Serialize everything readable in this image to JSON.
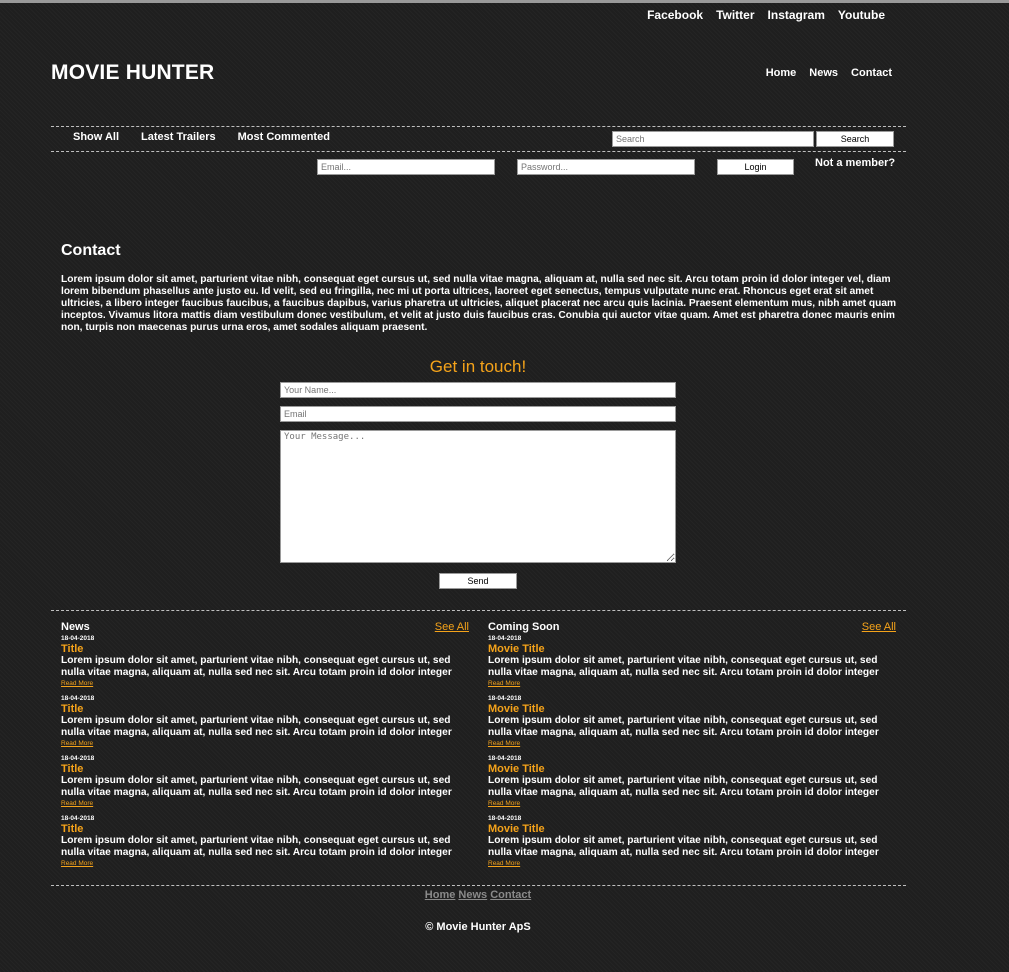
{
  "social": [
    "Facebook",
    "Twitter",
    "Instagram",
    "Youtube"
  ],
  "site_title": "MOVIE HUNTER",
  "main_nav": [
    "Home",
    "News",
    "Contact"
  ],
  "sub_nav": [
    "Show All",
    "Latest Trailers",
    "Most Commented"
  ],
  "search": {
    "placeholder": "Search",
    "button": "Search"
  },
  "login": {
    "email_placeholder": "Email...",
    "password_placeholder": "Password...",
    "button": "Login",
    "member_text": "Not a member?"
  },
  "contact": {
    "title": "Contact",
    "body": "Lorem ipsum dolor sit amet, parturient vitae nibh, consequat eget cursus ut, sed nulla vitae magna, aliquam at, nulla sed nec sit. Arcu totam proin id dolor integer vel, diam lorem bibendum phasellus ante justo eu. Id velit, sed eu fringilla, nec mi ut porta ultrices, laoreet eget senectus, tempus vulputate nunc erat. Rhoncus eget erat sit amet ultricies, a libero integer faucibus faucibus, a faucibus dapibus, varius pharetra ut ultricies, aliquet placerat nec arcu quis lacinia. Praesent elementum mus, nibh amet quam inceptos. Vivamus litora mattis diam vestibulum donec vestibulum, et velit at justo duis faucibus cras. Conubia qui auctor vitae quam. Amet est pharetra donec mauris enim non, turpis non maecenas purus urna eros, amet sodales aliquam praesent."
  },
  "form": {
    "heading": "Get in touch!",
    "name_placeholder": "Your Name...",
    "email_placeholder": "Email",
    "message_placeholder": "Your Message...",
    "send": "Send"
  },
  "news": {
    "heading": "News",
    "see_all": "See All",
    "items": [
      {
        "date": "18-04-2018",
        "title": "Title",
        "text": "Lorem ipsum dolor sit amet, parturient vitae nibh, consequat eget cursus ut, sed nulla vitae magna, aliquam at, nulla sed nec sit. Arcu totam proin id dolor integer vel, dia...",
        "read_more": "Read More"
      },
      {
        "date": "18-04-2018",
        "title": "Title",
        "text": "Lorem ipsum dolor sit amet, parturient vitae nibh, consequat eget cursus ut, sed nulla vitae magna, aliquam at, nulla sed nec sit. Arcu totam proin id dolor integer vel, dia...",
        "read_more": "Read More"
      },
      {
        "date": "18-04-2018",
        "title": "Title",
        "text": "Lorem ipsum dolor sit amet, parturient vitae nibh, consequat eget cursus ut, sed nulla vitae magna, aliquam at, nulla sed nec sit. Arcu totam proin id dolor integer vel, dia...",
        "read_more": "Read More"
      },
      {
        "date": "18-04-2018",
        "title": "Title",
        "text": "Lorem ipsum dolor sit amet, parturient vitae nibh, consequat eget cursus ut, sed nulla vitae magna, aliquam at, nulla sed nec sit. Arcu totam proin id dolor integer vel, dia...",
        "read_more": "Read More"
      }
    ]
  },
  "coming_soon": {
    "heading": "Coming Soon",
    "see_all": "See All",
    "items": [
      {
        "date": "18-04-2018",
        "title": "Movie Title",
        "text": "Lorem ipsum dolor sit amet, parturient vitae nibh, consequat eget cursus ut, sed nulla vitae magna, aliquam at, nulla sed nec sit. Arcu totam proin id dolor integer vel, dia...",
        "read_more": "Read More"
      },
      {
        "date": "18-04-2018",
        "title": "Movie Title",
        "text": "Lorem ipsum dolor sit amet, parturient vitae nibh, consequat eget cursus ut, sed nulla vitae magna, aliquam at, nulla sed nec sit. Arcu totam proin id dolor integer vel, dia...",
        "read_more": "Read More"
      },
      {
        "date": "18-04-2018",
        "title": "Movie Title",
        "text": "Lorem ipsum dolor sit amet, parturient vitae nibh, consequat eget cursus ut, sed nulla vitae magna, aliquam at, nulla sed nec sit. Arcu totam proin id dolor integer vel, dia...",
        "read_more": "Read More"
      },
      {
        "date": "18-04-2018",
        "title": "Movie Title",
        "text": "Lorem ipsum dolor sit amet, parturient vitae nibh, consequat eget cursus ut, sed nulla vitae magna, aliquam at, nulla sed nec sit. Arcu totam proin id dolor integer vel, dia...",
        "read_more": "Read More"
      }
    ]
  },
  "footer": {
    "nav": [
      "Home",
      "News",
      "Contact"
    ],
    "copyright": "© Movie Hunter ApS"
  },
  "colors": {
    "background": "#1f1f1f",
    "accent": "#f5a31a",
    "text": "#ffffff",
    "footer_link": "#8a8a8a"
  }
}
